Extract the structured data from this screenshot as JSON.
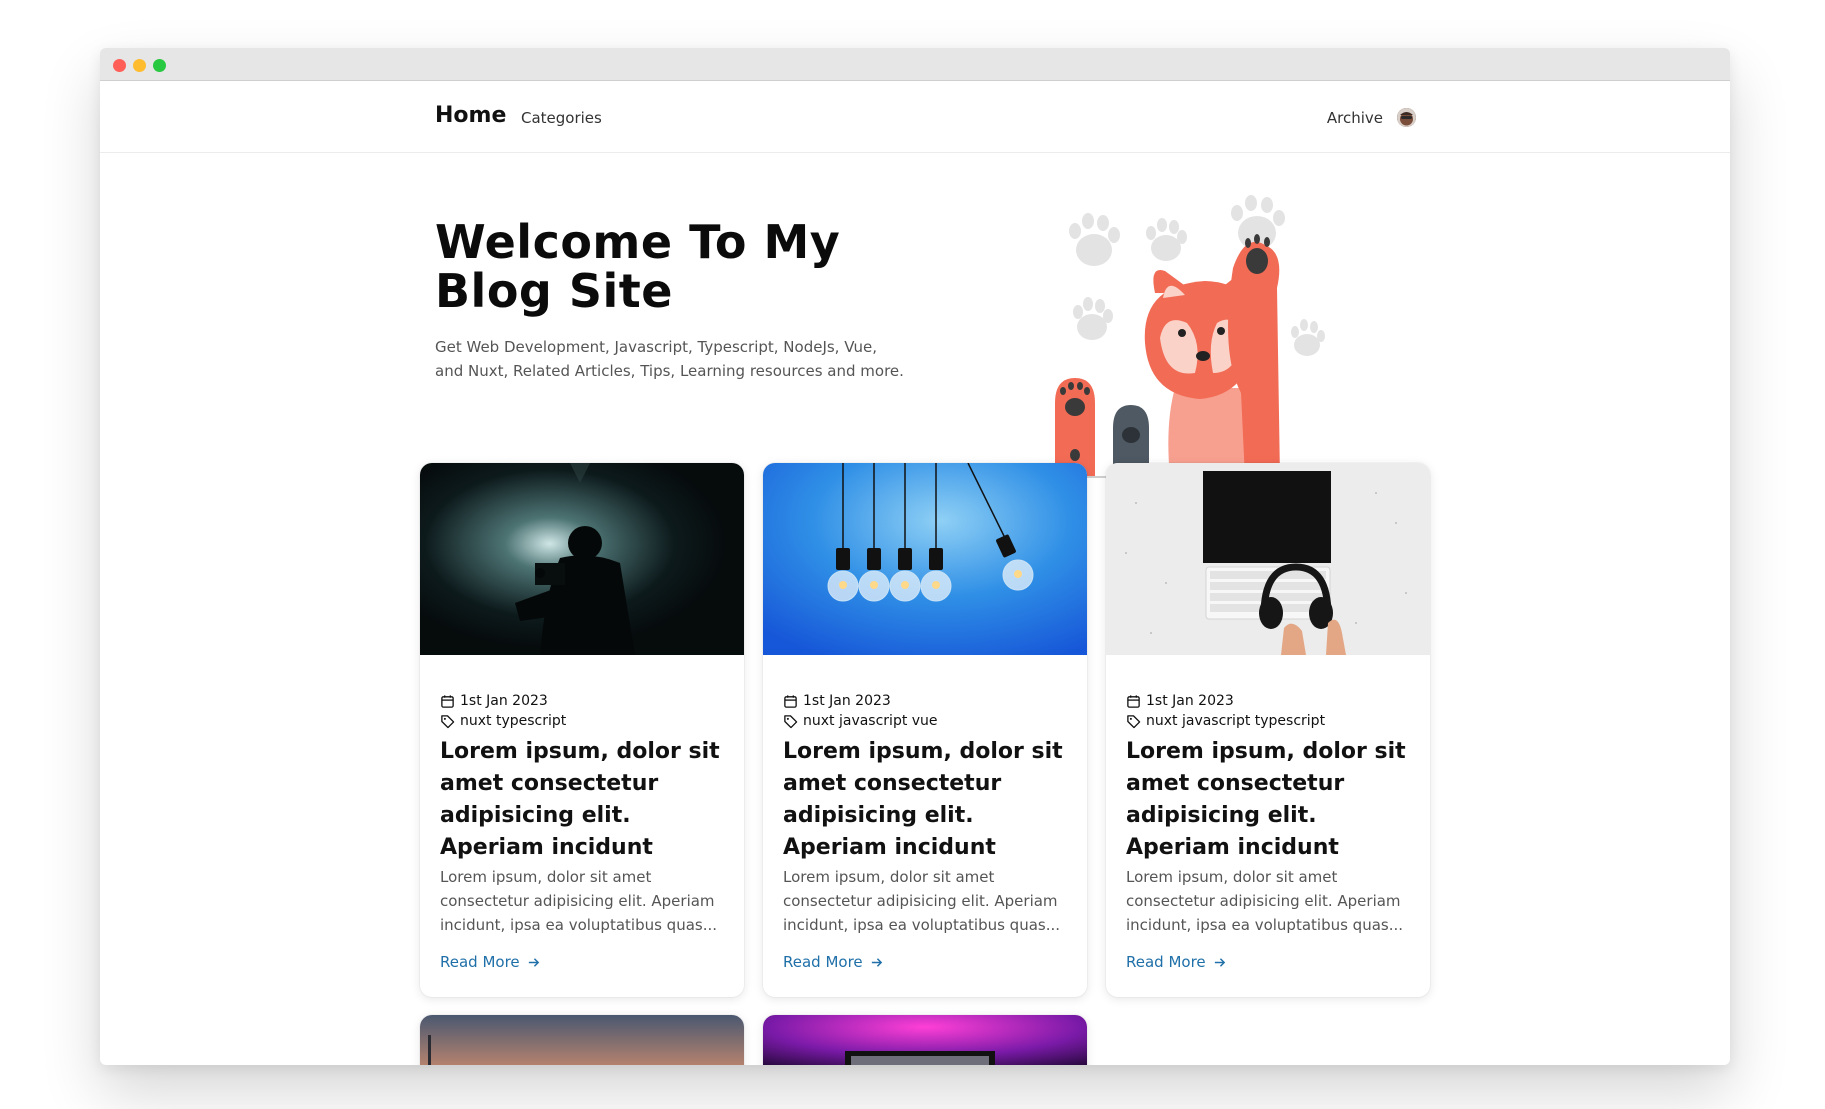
{
  "nav": {
    "home_label": "Home",
    "categories_label": "Categories",
    "archive_label": "Archive"
  },
  "hero": {
    "title": "Welcome To My Blog Site",
    "subtitle": "Get Web Development, Javascript, Typescript, NodeJs, Vue, and Nuxt, Related Articles, Tips, Learning resources and more."
  },
  "posts": [
    {
      "date": "1st Jan 2023",
      "tags": "nuxt typescript",
      "title": "Lorem ipsum, dolor sit amet consectetur adipisicing elit. Aperiam incidunt",
      "excerpt": "Lorem ipsum, dolor sit amet consectetur adipisicing elit. Aperiam incidunt, ipsa ea voluptatibus quas...",
      "read_more": "Read More",
      "image_icon": "videographer-silhouette-image"
    },
    {
      "date": "1st Jan 2023",
      "tags": "nuxt javascript vue",
      "title": "Lorem ipsum, dolor sit amet consectetur adipisicing elit. Aperiam incidunt",
      "excerpt": "Lorem ipsum, dolor sit amet consectetur adipisicing elit. Aperiam incidunt, ipsa ea voluptatibus quas...",
      "read_more": "Read More",
      "image_icon": "light-bulbs-image"
    },
    {
      "date": "1st Jan 2023",
      "tags": "nuxt javascript typescript",
      "title": "Lorem ipsum, dolor sit amet consectetur adipisicing elit. Aperiam incidunt",
      "excerpt": "Lorem ipsum, dolor sit amet consectetur adipisicing elit. Aperiam incidunt, ipsa ea voluptatibus quas...",
      "read_more": "Read More",
      "image_icon": "keyboard-headphones-image"
    }
  ],
  "colors": {
    "accent_link": "#1f6fa8",
    "illustration_orange": "#f26b55"
  }
}
